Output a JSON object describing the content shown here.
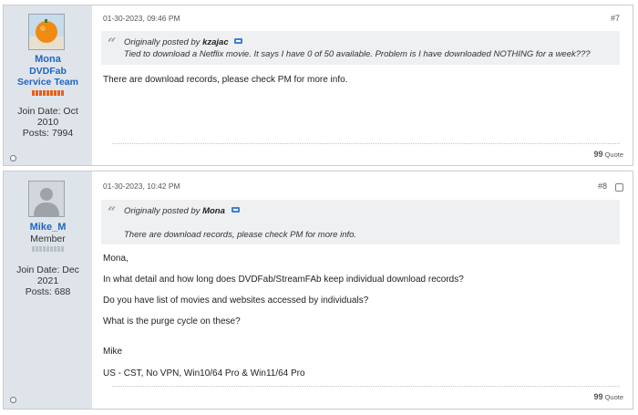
{
  "posts": [
    {
      "user": {
        "name": "Mona",
        "title_lines": [
          "DVDFab",
          "Service Team"
        ],
        "join_date_lines": [
          "Join Date: Oct",
          "2010"
        ],
        "posts": "Posts: 7994",
        "reputation_color": "#e8601c"
      },
      "date": "01-30-2023, 09:46 PM",
      "number": "#7",
      "quote": {
        "prefix": "Originally posted by",
        "author": "kzajac",
        "text": "Tied to download a Netflix movie. It says I have 0 of 50 available. Problem is I have downloaded NOTHING for a week???"
      },
      "body": [
        "There are download records, please check PM for more info."
      ],
      "quote_button": "Quote"
    },
    {
      "user": {
        "name": "Mike_M",
        "title_lines": [
          "Member"
        ],
        "join_date_lines": [
          "Join Date: Dec",
          "2021"
        ],
        "posts": "Posts: 688",
        "reputation_color": "#b8c0c8"
      },
      "date": "01-30-2023, 10:42 PM",
      "number": "#8",
      "quote": {
        "prefix": "Originally posted by",
        "author": "Mona",
        "text": "There are download records, please check PM for more info."
      },
      "body": [
        "Mona,",
        "In what detail and how long does DVDFab/StreamFAb keep individual download records?",
        "Do you have list of movies and websites accessed by individuals?",
        "What is the purge cycle on these?",
        "Mike",
        "US - CST, No VPN, Win10/64 Pro & Win11/64 Pro"
      ],
      "quote_button": "Quote"
    }
  ],
  "colors": {
    "username": "#1f66c0",
    "sidebar": "#dfe4ea",
    "quote_bg": "#eef0f2"
  }
}
